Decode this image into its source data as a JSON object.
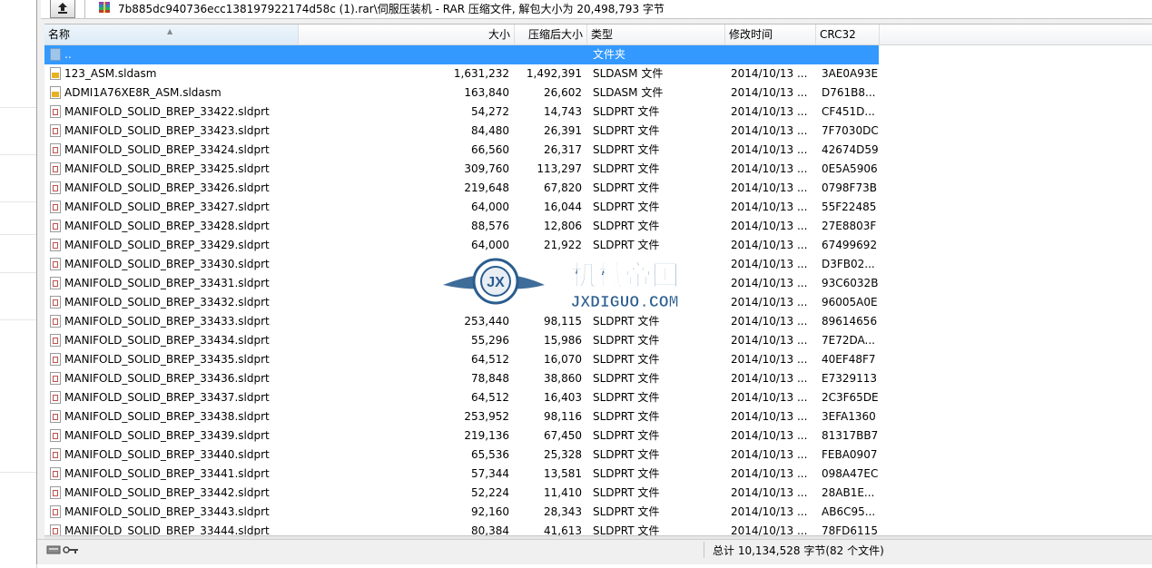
{
  "address": {
    "path": "7b885dc940736ecc138197922174d58c (1).rar\\伺服压装机 - RAR 压缩文件, 解包大小为 20,498,793 字节"
  },
  "columns": {
    "name": "名称",
    "size": "大小",
    "packed": "压缩后大小",
    "type": "类型",
    "modified": "修改时间",
    "crc": "CRC32"
  },
  "parent_row": {
    "name": "..",
    "type": "文件夹"
  },
  "files": [
    {
      "name": "123_ASM.sldasm",
      "size": "1,631,232",
      "packed": "1,492,391",
      "type": "SLDASM 文件",
      "modified": "2014/10/13 ...",
      "crc": "3AE0A93E",
      "kind": "asm"
    },
    {
      "name": "ADMI1A76XE8R_ASM.sldasm",
      "size": "163,840",
      "packed": "26,602",
      "type": "SLDASM 文件",
      "modified": "2014/10/13 ...",
      "crc": "D761B8...",
      "kind": "asm"
    },
    {
      "name": "MANIFOLD_SOLID_BREP_33422.sldprt",
      "size": "54,272",
      "packed": "14,743",
      "type": "SLDPRT 文件",
      "modified": "2014/10/13 ...",
      "crc": "CF451D...",
      "kind": "prt"
    },
    {
      "name": "MANIFOLD_SOLID_BREP_33423.sldprt",
      "size": "84,480",
      "packed": "26,391",
      "type": "SLDPRT 文件",
      "modified": "2014/10/13 ...",
      "crc": "7F7030DC",
      "kind": "prt"
    },
    {
      "name": "MANIFOLD_SOLID_BREP_33424.sldprt",
      "size": "66,560",
      "packed": "26,317",
      "type": "SLDPRT 文件",
      "modified": "2014/10/13 ...",
      "crc": "42674D59",
      "kind": "prt"
    },
    {
      "name": "MANIFOLD_SOLID_BREP_33425.sldprt",
      "size": "309,760",
      "packed": "113,297",
      "type": "SLDPRT 文件",
      "modified": "2014/10/13 ...",
      "crc": "0E5A5906",
      "kind": "prt"
    },
    {
      "name": "MANIFOLD_SOLID_BREP_33426.sldprt",
      "size": "219,648",
      "packed": "67,820",
      "type": "SLDPRT 文件",
      "modified": "2014/10/13 ...",
      "crc": "0798F73B",
      "kind": "prt"
    },
    {
      "name": "MANIFOLD_SOLID_BREP_33427.sldprt",
      "size": "64,000",
      "packed": "16,044",
      "type": "SLDPRT 文件",
      "modified": "2014/10/13 ...",
      "crc": "55F22485",
      "kind": "prt"
    },
    {
      "name": "MANIFOLD_SOLID_BREP_33428.sldprt",
      "size": "88,576",
      "packed": "12,806",
      "type": "SLDPRT 文件",
      "modified": "2014/10/13 ...",
      "crc": "27E8803F",
      "kind": "prt"
    },
    {
      "name": "MANIFOLD_SOLID_BREP_33429.sldprt",
      "size": "64,000",
      "packed": "21,922",
      "type": "SLDPRT 文件",
      "modified": "2014/10/13 ...",
      "crc": "67499692",
      "kind": "prt"
    },
    {
      "name": "MANIFOLD_SOLID_BREP_33430.sldprt",
      "size": "",
      "packed": "",
      "type": "",
      "modified": "2014/10/13 ...",
      "crc": "D3FB02...",
      "kind": "prt"
    },
    {
      "name": "MANIFOLD_SOLID_BREP_33431.sldprt",
      "size": "",
      "packed": "",
      "type": "",
      "modified": "2014/10/13 ...",
      "crc": "93C6032B",
      "kind": "prt"
    },
    {
      "name": "MANIFOLD_SOLID_BREP_33432.sldprt",
      "size": "",
      "packed": "",
      "type": "",
      "modified": "2014/10/13 ...",
      "crc": "96005A0E",
      "kind": "prt"
    },
    {
      "name": "MANIFOLD_SOLID_BREP_33433.sldprt",
      "size": "253,440",
      "packed": "98,115",
      "type": "SLDPRT 文件",
      "modified": "2014/10/13 ...",
      "crc": "89614656",
      "kind": "prt"
    },
    {
      "name": "MANIFOLD_SOLID_BREP_33434.sldprt",
      "size": "55,296",
      "packed": "15,986",
      "type": "SLDPRT 文件",
      "modified": "2014/10/13 ...",
      "crc": "7E72DA...",
      "kind": "prt"
    },
    {
      "name": "MANIFOLD_SOLID_BREP_33435.sldprt",
      "size": "64,512",
      "packed": "16,070",
      "type": "SLDPRT 文件",
      "modified": "2014/10/13 ...",
      "crc": "40EF48F7",
      "kind": "prt"
    },
    {
      "name": "MANIFOLD_SOLID_BREP_33436.sldprt",
      "size": "78,848",
      "packed": "38,860",
      "type": "SLDPRT 文件",
      "modified": "2014/10/13 ...",
      "crc": "E7329113",
      "kind": "prt"
    },
    {
      "name": "MANIFOLD_SOLID_BREP_33437.sldprt",
      "size": "64,512",
      "packed": "16,403",
      "type": "SLDPRT 文件",
      "modified": "2014/10/13 ...",
      "crc": "2C3F65DE",
      "kind": "prt"
    },
    {
      "name": "MANIFOLD_SOLID_BREP_33438.sldprt",
      "size": "253,952",
      "packed": "98,116",
      "type": "SLDPRT 文件",
      "modified": "2014/10/13 ...",
      "crc": "3EFA1360",
      "kind": "prt"
    },
    {
      "name": "MANIFOLD_SOLID_BREP_33439.sldprt",
      "size": "219,136",
      "packed": "67,450",
      "type": "SLDPRT 文件",
      "modified": "2014/10/13 ...",
      "crc": "81317BB7",
      "kind": "prt"
    },
    {
      "name": "MANIFOLD_SOLID_BREP_33440.sldprt",
      "size": "65,536",
      "packed": "25,328",
      "type": "SLDPRT 文件",
      "modified": "2014/10/13 ...",
      "crc": "FEBA0907",
      "kind": "prt"
    },
    {
      "name": "MANIFOLD_SOLID_BREP_33441.sldprt",
      "size": "57,344",
      "packed": "13,581",
      "type": "SLDPRT 文件",
      "modified": "2014/10/13 ...",
      "crc": "098A47EC",
      "kind": "prt"
    },
    {
      "name": "MANIFOLD_SOLID_BREP_33442.sldprt",
      "size": "52,224",
      "packed": "11,410",
      "type": "SLDPRT 文件",
      "modified": "2014/10/13 ...",
      "crc": "28AB1E...",
      "kind": "prt"
    },
    {
      "name": "MANIFOLD_SOLID_BREP_33443.sldprt",
      "size": "92,160",
      "packed": "28,343",
      "type": "SLDPRT 文件",
      "modified": "2014/10/13 ...",
      "crc": "AB6C95...",
      "kind": "prt"
    },
    {
      "name": "MANIFOLD_SOLID_BREP_33444.sldprt",
      "size": "80,384",
      "packed": "41,613",
      "type": "SLDPRT 文件",
      "modified": "2014/10/13 ...",
      "crc": "78FD6115",
      "kind": "prt"
    }
  ],
  "status": {
    "summary": "总计 10,134,528 字节(82 个文件)"
  },
  "watermark": {
    "cn_text": "机械帝国",
    "en_text": "JXDIGUO.COM",
    "badge_text": "JX"
  },
  "colors": {
    "selection": "#3399ff",
    "watermark_blue": "#2a5d8f"
  }
}
